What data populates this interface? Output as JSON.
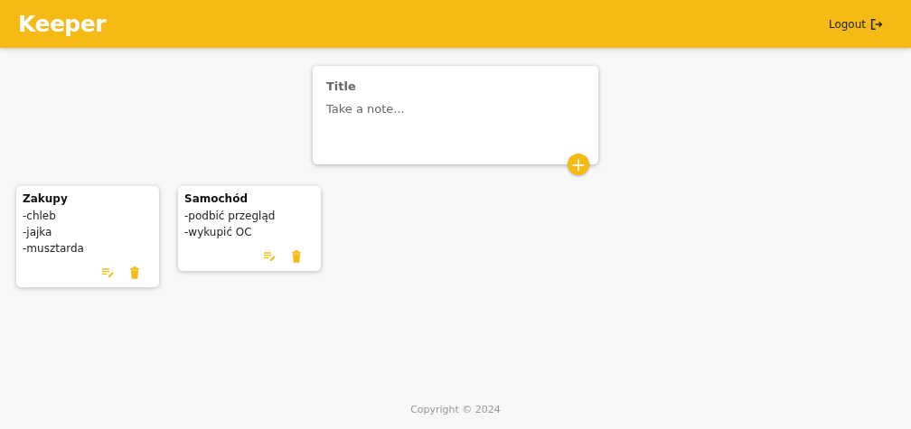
{
  "header": {
    "title": "Keeper",
    "logout": "Logout"
  },
  "create_note": {
    "title_placeholder": "Title",
    "content_placeholder": "Take a note...",
    "add_button": "+"
  },
  "notes": [
    {
      "title": "Zakupy",
      "lines": [
        "-chleb",
        "-jajka",
        "-musztarda"
      ]
    },
    {
      "title": "Samochód",
      "lines": [
        "-podbić przegląd",
        "-wykupić OC"
      ]
    }
  ],
  "footer": {
    "copyright": "Copyright © 2024"
  }
}
